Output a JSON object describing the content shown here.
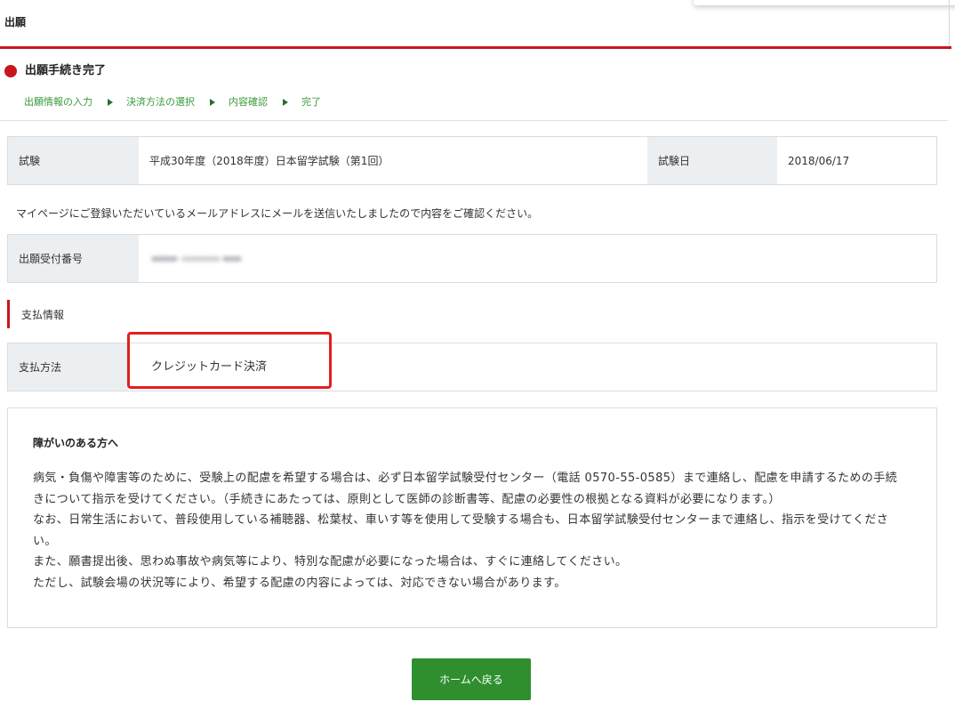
{
  "header": {
    "title": "出願"
  },
  "page": {
    "title": "出願手続き完了"
  },
  "steps": [
    "出願情報の入力",
    "決済方法の選択",
    "内容確認",
    "完了"
  ],
  "exam": {
    "label": "試験",
    "value": "平成30年度（2018年度）日本留学試験（第1回）",
    "date_label": "試験日",
    "date_value": "2018/06/17"
  },
  "message": "マイページにご登録いただいているメールアドレスにメールを送信いたしましたので内容をご確認ください。",
  "receipt": {
    "label": "出願受付番号"
  },
  "payment": {
    "section_title": "支払情報",
    "method_label": "支払方法",
    "method_value": "クレジットカード決済"
  },
  "notice": {
    "title": "障がいのある方へ",
    "paragraphs": [
      "病気・負傷や障害等のために、受験上の配慮を希望する場合は、必ず日本留学試験受付センター（電話 0570-55-0585）まで連絡し、配慮を申請するための手続きについて指示を受けてください。（手続きにあたっては、原則として医師の診断書等、配慮の必要性の根拠となる資料が必要になります。）",
      "なお、日常生活において、普段使用している補聴器、松葉杖、車いす等を使用して受験する場合も、日本留学試験受付センターまで連絡し、指示を受けてください。",
      "また、願書提出後、思わぬ事故や病気等により、特別な配慮が必要になった場合は、すぐに連絡してください。",
      "ただし、試験会場の状況等により、希望する配慮の内容によっては、対応できない場合があります。"
    ]
  },
  "home_button": {
    "label": "ホームへ戻る"
  },
  "icons": {
    "title_marker": "red-dot-icon",
    "step_separator": "triangle-right-icon"
  },
  "colors": {
    "accent_red": "#c8161d",
    "step_green": "#3a9a3a",
    "step_arrow_green": "#2b6e2b",
    "button_green": "#2f8f2f",
    "label_bg": "#eceff2",
    "highlight_red": "#e0201f"
  }
}
